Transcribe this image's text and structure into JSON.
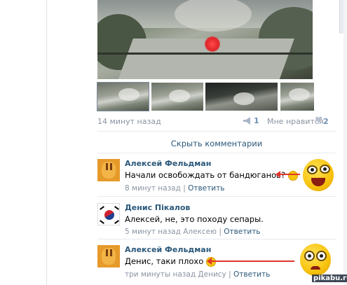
{
  "post": {
    "time": "14 минут назад",
    "share_count": "1",
    "like_label": "Мне нравится",
    "like_count": "2"
  },
  "comments_toggle": "Скрыть комментарии",
  "comments": [
    {
      "author": "Алексей Фельдман",
      "text": "Начали освобождать от бандюганов?",
      "time": "8 минут назад",
      "reply": "Ответить"
    },
    {
      "author": "Денис Пікалов",
      "text": "Алексей, не, это походу сепары.",
      "time": "5 минут назад Алексею",
      "reply": "Ответить"
    },
    {
      "author": "Алексей Фельдман",
      "text": "Денис, таки плохо",
      "time": "три минуты назад Денису",
      "reply": "Ответить"
    }
  ],
  "watermark": "pikabu.ru",
  "colors": {
    "link": "#2b587a",
    "meta": "#8a94a2",
    "arrow": "#e0352b"
  }
}
